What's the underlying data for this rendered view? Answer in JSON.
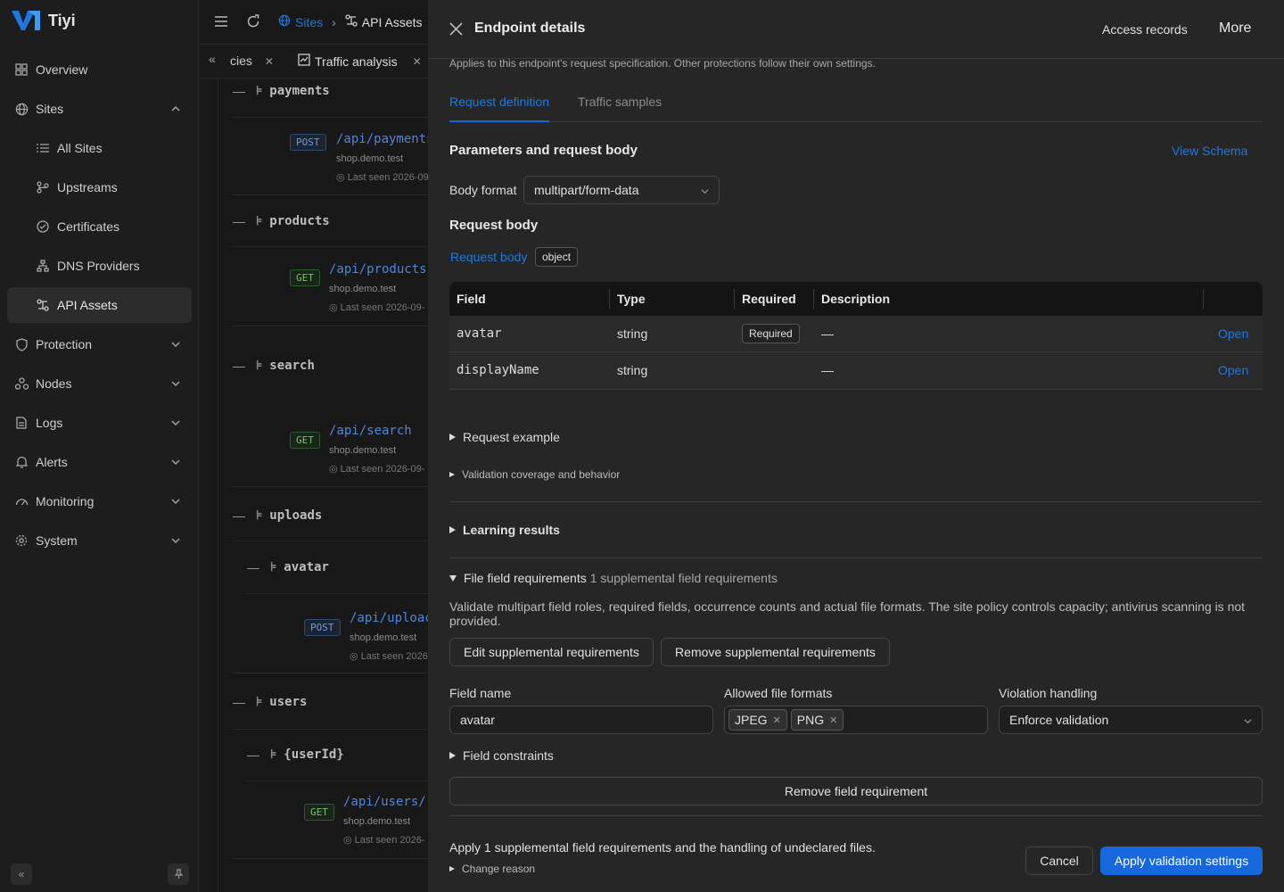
{
  "app": {
    "name": "Tiyi"
  },
  "sidebar": {
    "items": [
      {
        "label": "Overview",
        "icon": "overview-icon"
      },
      {
        "label": "Sites",
        "icon": "globe-icon"
      },
      {
        "label": "All Sites",
        "icon": "list-icon"
      },
      {
        "label": "Upstreams",
        "icon": "branch-icon"
      },
      {
        "label": "Certificates",
        "icon": "certificate-icon"
      },
      {
        "label": "DNS Providers",
        "icon": "network-icon"
      },
      {
        "label": "API Assets",
        "icon": "api-assets-icon"
      },
      {
        "label": "Protection",
        "icon": "shield-icon"
      },
      {
        "label": "Nodes",
        "icon": "nodes-icon"
      },
      {
        "label": "Logs",
        "icon": "logs-icon"
      },
      {
        "label": "Alerts",
        "icon": "bell-icon"
      },
      {
        "label": "Monitoring",
        "icon": "gauge-icon"
      },
      {
        "label": "System",
        "icon": "gear-icon"
      }
    ],
    "active": "API Assets"
  },
  "topbar": {
    "breadcrumb": [
      "Sites",
      "API Assets"
    ]
  },
  "tabs": [
    {
      "label": "cies"
    },
    {
      "label": "Traffic analysis"
    }
  ],
  "tree": {
    "nodes": [
      "payments",
      "products",
      "search",
      "uploads",
      "avatar",
      "users",
      "{userId}"
    ],
    "endpoints": [
      {
        "method": "POST",
        "path": "/api/payments",
        "host": "shop.demo.test",
        "seen": "Last seen 2026-09"
      },
      {
        "method": "GET",
        "path": "/api/products",
        "host": "shop.demo.test",
        "seen": "Last seen 2026-09-"
      },
      {
        "method": "GET",
        "path": "/api/search",
        "host": "shop.demo.test",
        "seen": "Last seen 2026-09-"
      },
      {
        "method": "POST",
        "path": "/api/uploac",
        "host": "shop.demo.test",
        "seen": "Last seen 2026"
      },
      {
        "method": "GET",
        "path": "/api/users/-",
        "host": "shop.demo.test",
        "seen": "Last seen 2026-"
      }
    ]
  },
  "drawer": {
    "title": "Endpoint details",
    "access_records": "Access records",
    "more": "More",
    "scope_note": "Applies to this endpoint's request specification. Other protections follow their own settings.",
    "tabs": [
      "Request definition",
      "Traffic samples"
    ],
    "params_title": "Parameters and request body",
    "view_schema": "View Schema",
    "body_format_label": "Body format",
    "body_format_value": "multipart/form-data",
    "request_body_title": "Request body",
    "request_body_link": "Request body",
    "request_body_type": "object",
    "table": {
      "headers": [
        "Field",
        "Type",
        "Required",
        "Description"
      ],
      "rows": [
        {
          "field": "avatar",
          "type": "string",
          "required": "Required",
          "description": "—",
          "action": "Open"
        },
        {
          "field": "displayName",
          "type": "string",
          "required": "",
          "description": "—",
          "action": "Open"
        }
      ]
    },
    "request_example": "Request example",
    "validation_coverage": "Validation coverage and behavior",
    "learning_results": "Learning results",
    "file_req_title": "File field requirements",
    "file_req_count": "1 supplemental field requirements",
    "file_req_desc": "Validate multipart field roles, required fields, occurrence counts and actual file formats. The site policy controls capacity; antivirus scanning is not provided.",
    "edit_btn": "Edit supplemental requirements",
    "remove_btn": "Remove supplemental requirements",
    "field_name_label": "Field name",
    "field_name_value": "avatar",
    "formats_label": "Allowed file formats",
    "formats": [
      "JPEG",
      "PNG"
    ],
    "violation_label": "Violation handling",
    "violation_value": "Enforce validation",
    "field_constraints": "Field constraints",
    "remove_field_btn": "Remove field requirement",
    "footer_summary": "Apply 1 supplemental field requirements and the handling of undeclared files.",
    "change_reason": "Change reason",
    "cancel": "Cancel",
    "apply": "Apply validation settings"
  },
  "colors": {
    "accent": "#1668dc",
    "link": "#1f78e0",
    "bg": "#262626"
  }
}
